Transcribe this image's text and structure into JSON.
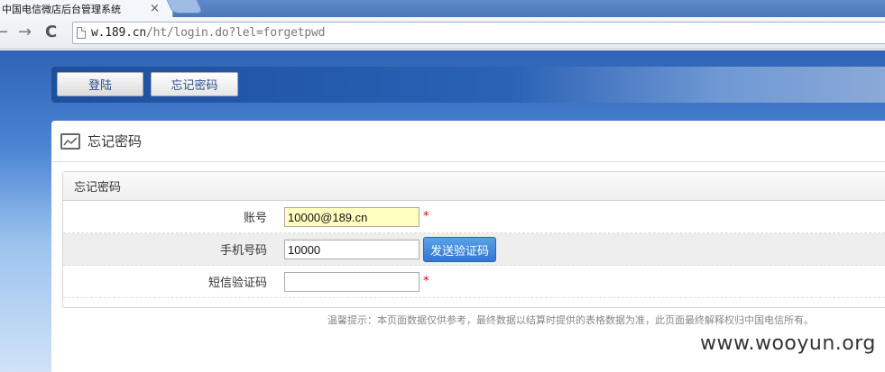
{
  "browser": {
    "tab_title": "中国电信微店后台管理系统",
    "tab_close": "×",
    "back": "←",
    "forward": "→",
    "reload": "C",
    "url_host": "w.189.cn",
    "url_path": "/ht/login.do?lel=forgetpwd"
  },
  "header": {
    "login_label": "登陆",
    "forgot_label": "忘记密码"
  },
  "panel": {
    "title": "忘记密码",
    "section_title": "忘记密码"
  },
  "form": {
    "account_label": "账号",
    "account_value": "10000@189.cn",
    "phone_label": "手机号码",
    "phone_value": "10000",
    "send_code_label": "发送验证码",
    "sms_label": "短信验证码",
    "sms_value": "",
    "required_mark": "*"
  },
  "tip": "温馨提示：本页面数据仅供参考，最终数据以结算时提供的表格数据为准，此页面最终解释权归中国电信所有。",
  "watermark": "www.wooyun.org",
  "colors": {
    "accent_blue": "#2a62b6",
    "send_button": "#3d87db",
    "required": "#e00000",
    "autofill": "#ffffc0"
  }
}
